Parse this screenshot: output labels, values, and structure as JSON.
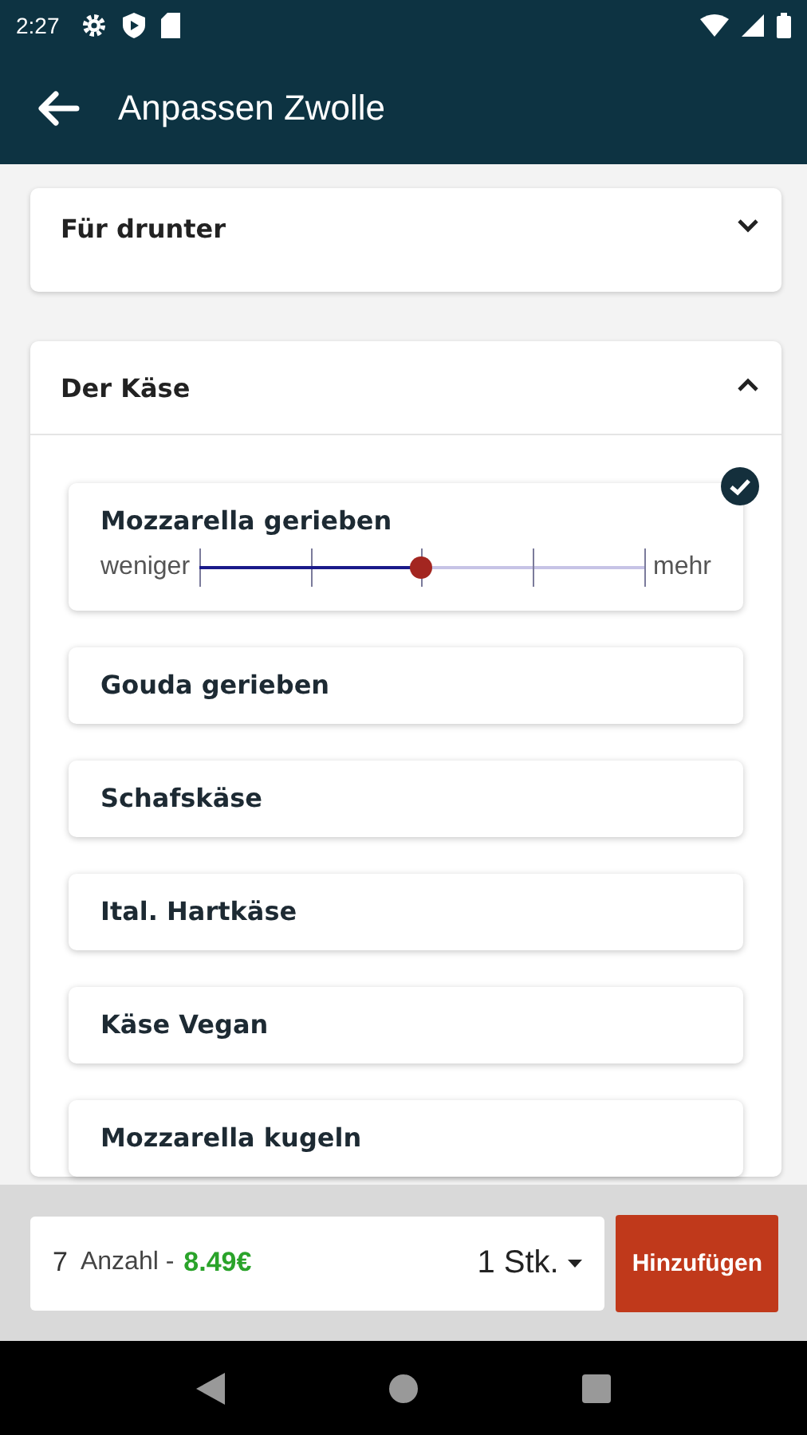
{
  "status_bar": {
    "time": "2:27"
  },
  "toolbar": {
    "title": "Anpassen Zwolle"
  },
  "sections": [
    {
      "title": "Für drunter",
      "expanded": false
    },
    {
      "title": "Der Käse",
      "expanded": true,
      "items": [
        {
          "name": "Mozzarella gerieben",
          "selected": true,
          "slider": {
            "min_label": "weniger",
            "max_label": "mehr",
            "level": 0.5
          }
        },
        {
          "name": "Gouda gerieben",
          "selected": false
        },
        {
          "name": "Schafskäse",
          "selected": false
        },
        {
          "name": "Ital. Hartkäse",
          "selected": false
        },
        {
          "name": "Käse Vegan",
          "selected": false
        },
        {
          "name": "Mozzarella kugeln",
          "selected": false
        }
      ]
    }
  ],
  "footer": {
    "quantity": "7",
    "quantity_label": "Anzahl -",
    "price": "8.49€",
    "unit": "1 Stk.",
    "add_button": "Hinzufügen"
  }
}
